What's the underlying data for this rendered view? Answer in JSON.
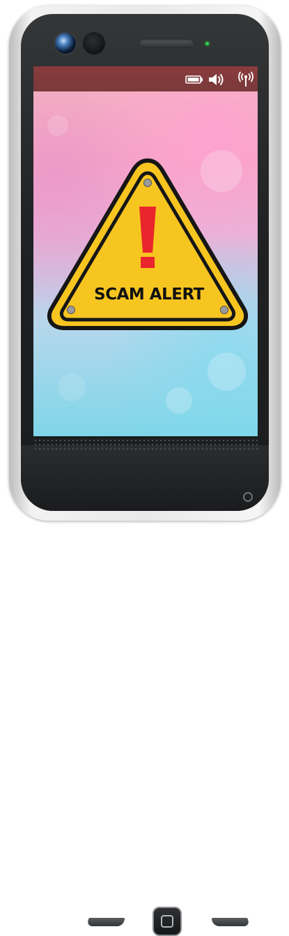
{
  "screen": {
    "alert_text": "SCAM ALERT"
  },
  "status_icons": [
    "battery-icon",
    "volume-icon",
    "signal-icon"
  ],
  "colors": {
    "sign_yellow": "#f7c520",
    "exclamation_red": "#e8262b",
    "status_bar": "#7e3a3b",
    "led": "#2fd14a"
  }
}
